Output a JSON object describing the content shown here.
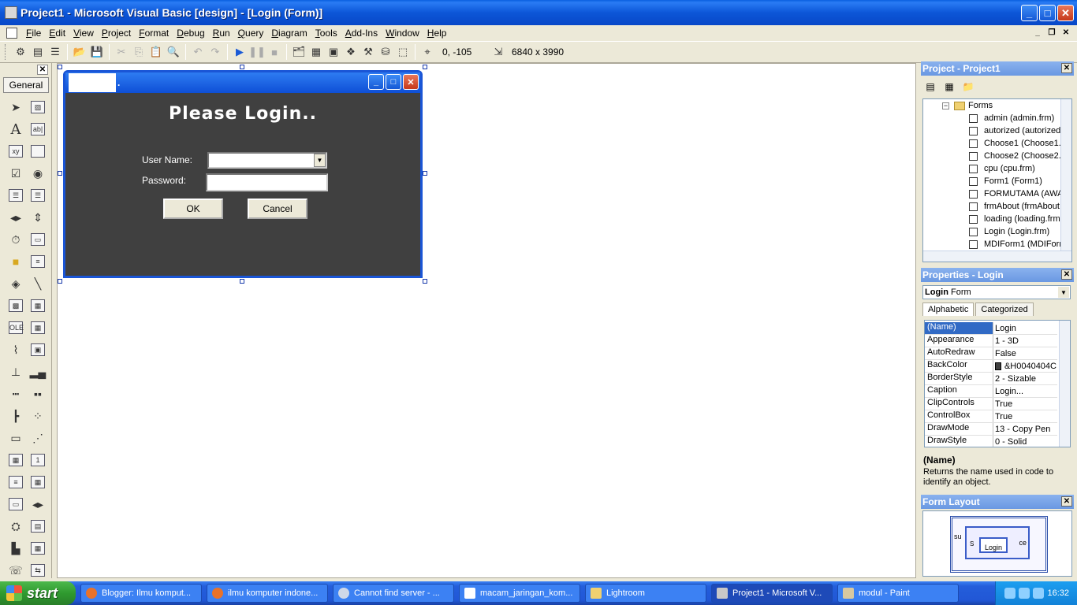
{
  "window": {
    "title": "Project1 - Microsoft Visual Basic [design] - [Login (Form)]"
  },
  "menu": [
    "File",
    "Edit",
    "View",
    "Project",
    "Format",
    "Debug",
    "Run",
    "Query",
    "Diagram",
    "Tools",
    "Add-Ins",
    "Window",
    "Help"
  ],
  "toolbar": {
    "coords": "0, -105",
    "size": "6840 x 3990"
  },
  "toolbox": {
    "tab": "General"
  },
  "form": {
    "title": "Please Login..",
    "caption_dot": ".",
    "username_label": "User Name:",
    "password_label": "Password:",
    "ok_label": "OK",
    "cancel_label": "Cancel"
  },
  "project": {
    "title": "Project - Project1",
    "folder": "Forms",
    "items": [
      "admin (admin.frm)",
      "autorized (autorized",
      "Choose1 (Choose1.",
      "Choose2 (Choose2.",
      "cpu (cpu.frm)",
      "Form1 (Form1)",
      "FORMUTAMA (AWA",
      "frmAbout (frmAbout",
      "loading (loading.frm",
      "Login (Login.frm)",
      "MDIForm1 (MDIForm"
    ]
  },
  "properties": {
    "title": "Properties - Login",
    "object_name": "Login",
    "object_type": "Form",
    "tabs": [
      "Alphabetic",
      "Categorized"
    ],
    "rows": [
      {
        "name": "(Name)",
        "value": "Login"
      },
      {
        "name": "Appearance",
        "value": "1 - 3D"
      },
      {
        "name": "AutoRedraw",
        "value": "False"
      },
      {
        "name": "BackColor",
        "value": "&H0040404C"
      },
      {
        "name": "BorderStyle",
        "value": "2 - Sizable"
      },
      {
        "name": "Caption",
        "value": "Login..."
      },
      {
        "name": "ClipControls",
        "value": "True"
      },
      {
        "name": "ControlBox",
        "value": "True"
      },
      {
        "name": "DrawMode",
        "value": "13 - Copy Pen"
      },
      {
        "name": "DrawStyle",
        "value": "0 - Solid"
      }
    ],
    "desc_name": "(Name)",
    "desc_text": "Returns the name used in code to identify an object."
  },
  "form_layout": {
    "title": "Form Layout",
    "mini_label": "Login",
    "left_text": "su",
    "right_text": "ce",
    "inner_text": "S"
  },
  "taskbar": {
    "start": "start",
    "tasks": [
      "Blogger: Ilmu komput...",
      "ilmu komputer indone...",
      "Cannot find server - ...",
      "macam_jaringan_kom...",
      "Lightroom",
      "Project1 - Microsoft V...",
      "modul - Paint"
    ],
    "clock": "16:32"
  }
}
